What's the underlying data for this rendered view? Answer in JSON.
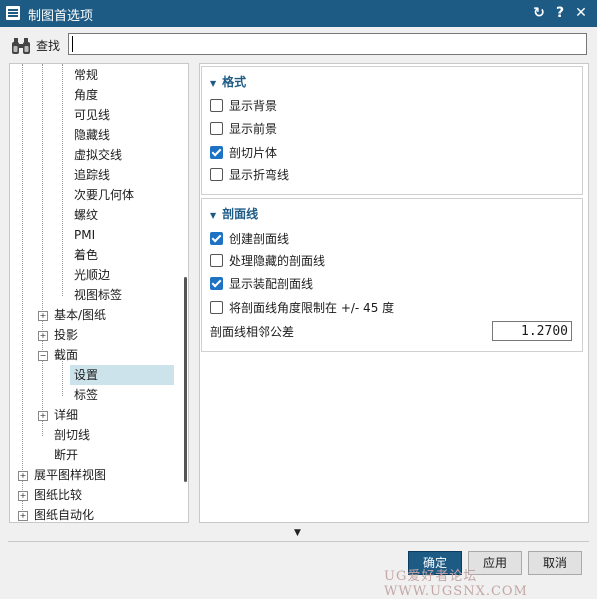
{
  "window": {
    "title": "制图首选项",
    "reset_icon": "↻",
    "help_icon": "?",
    "close_icon": "✕"
  },
  "search": {
    "label": "查找",
    "value": ""
  },
  "tree": {
    "items": [
      {
        "label": "常规"
      },
      {
        "label": "角度"
      },
      {
        "label": "可见线"
      },
      {
        "label": "隐藏线"
      },
      {
        "label": "虚拟交线"
      },
      {
        "label": "追踪线"
      },
      {
        "label": "次要几何体"
      },
      {
        "label": "螺纹"
      },
      {
        "label": "PMI"
      },
      {
        "label": "着色"
      },
      {
        "label": "光顺边"
      },
      {
        "label": "视图标签"
      },
      {
        "label": "基本/图纸"
      },
      {
        "label": "投影"
      },
      {
        "label": "截面"
      },
      {
        "label": "设置"
      },
      {
        "label": "标签"
      },
      {
        "label": "详细"
      },
      {
        "label": "剖切线"
      },
      {
        "label": "断开"
      },
      {
        "label": "展平图样视图"
      },
      {
        "label": "图纸比较"
      },
      {
        "label": "图纸自动化"
      }
    ],
    "selected": "设置"
  },
  "format_group": {
    "title": "格式",
    "options": [
      {
        "label": "显示背景",
        "checked": false
      },
      {
        "label": "显示前景",
        "checked": false
      },
      {
        "label": "剖切片体",
        "checked": true
      },
      {
        "label": "显示折弯线",
        "checked": false
      }
    ]
  },
  "hatch_group": {
    "title": "剖面线",
    "options": [
      {
        "label": "创建剖面线",
        "checked": true
      },
      {
        "label": "处理隐藏的剖面线",
        "checked": false
      },
      {
        "label": "显示装配剖面线",
        "checked": true
      },
      {
        "label": "将剖面线角度限制在 +/- 45 度",
        "checked": false
      }
    ],
    "tolerance_label": "剖面线相邻公差",
    "tolerance_value": "1.2700"
  },
  "buttons": {
    "ok": "确定",
    "apply": "应用",
    "cancel": "取消"
  },
  "watermark": "UG爱好者论坛 WWW.UGSNX.COM",
  "colors": {
    "title_bar": "#1d5b85",
    "accent": "#1d72c4",
    "selection": "#cde3ec"
  }
}
